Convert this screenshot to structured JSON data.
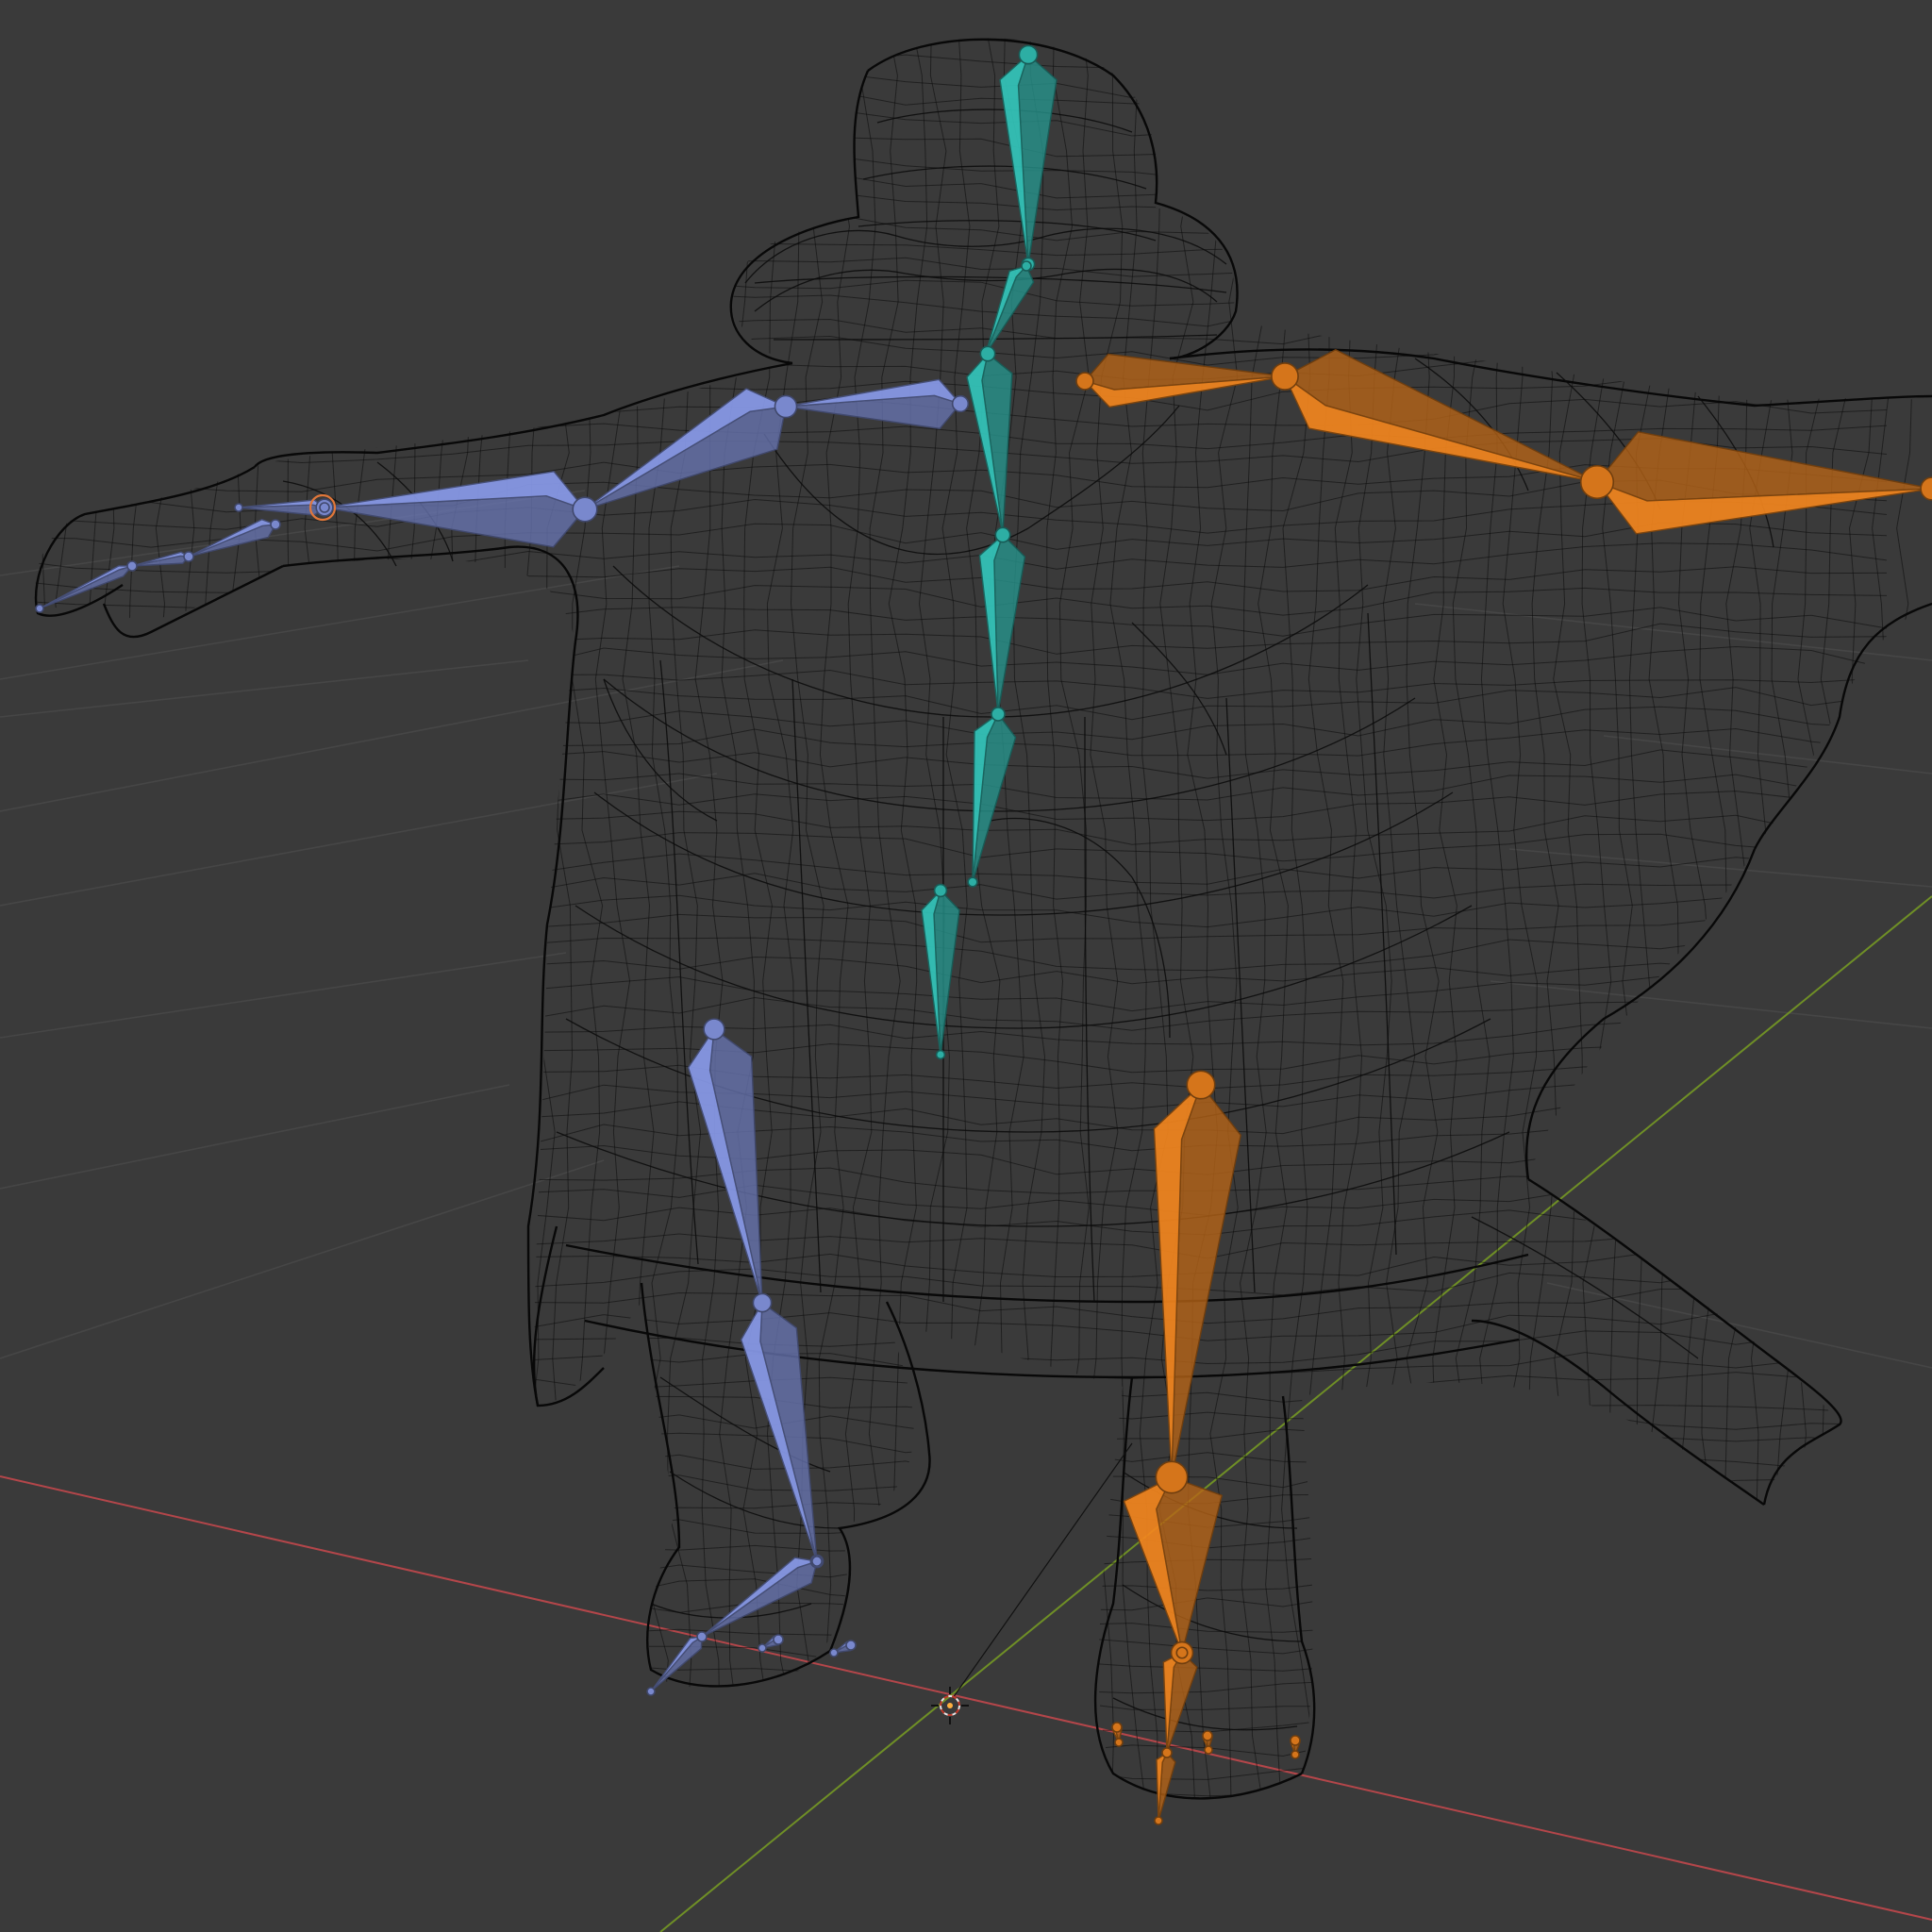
{
  "viewport": {
    "editor": "3D Viewport",
    "shading": "wireframe",
    "object": "character-mesh",
    "armature": "metarig"
  },
  "colors": {
    "background": "#3a3a3a",
    "grid": "#464646",
    "axis_x": "#b4464a",
    "axis_y": "#6f8f26",
    "wireframe": "#0b0b0b",
    "bones_center": "#2fb7ad",
    "bones_left": "#7f8fd8",
    "bones_right": "#e07b1c"
  },
  "icons": {
    "origin": "3d-cursor-icon"
  }
}
